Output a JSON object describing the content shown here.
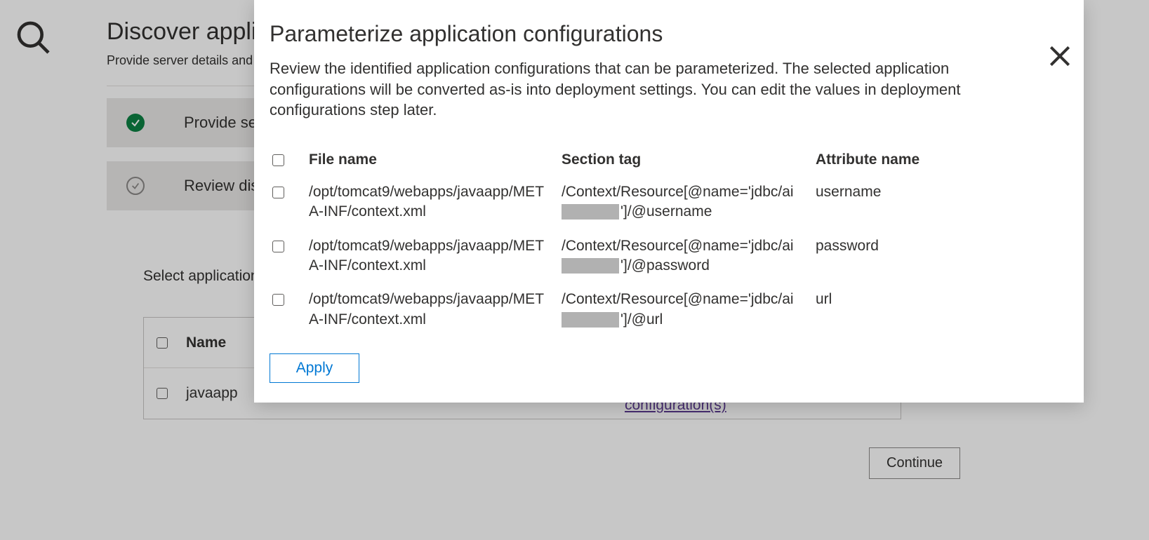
{
  "background": {
    "heading": "Discover applica",
    "subheading": "Provide server details and run",
    "step1_label": "Provide se",
    "step2_label": "Review dis",
    "select_apps_label": "Select applications",
    "table_header_name": "Name",
    "row_name": "javaapp",
    "config_link": "configuration(s)",
    "continue_label": "Continue"
  },
  "modal": {
    "title": "Parameterize application configurations",
    "description": "Review the identified application configurations that can be parameterized. The selected application configurations will be converted as-is into deployment settings. You can edit the values in deployment configurations step later.",
    "headers": {
      "file": "File name",
      "section": "Section tag",
      "attribute": "Attribute name"
    },
    "rows": [
      {
        "file": "/opt/tomcat9/webapps/javaapp/META-INF/context.xml",
        "section_pre": "/Context/Resource[@name='jdbc/ai",
        "section_post": "']/@username",
        "attribute": "username"
      },
      {
        "file": "/opt/tomcat9/webapps/javaapp/META-INF/context.xml",
        "section_pre": "/Context/Resource[@name='jdbc/ai",
        "section_post": "']/@password",
        "attribute": "password"
      },
      {
        "file": "/opt/tomcat9/webapps/javaapp/META-INF/context.xml",
        "section_pre": "/Context/Resource[@name='jdbc/ai",
        "section_post": "']/@url",
        "attribute": "url"
      }
    ],
    "apply_label": "Apply"
  }
}
